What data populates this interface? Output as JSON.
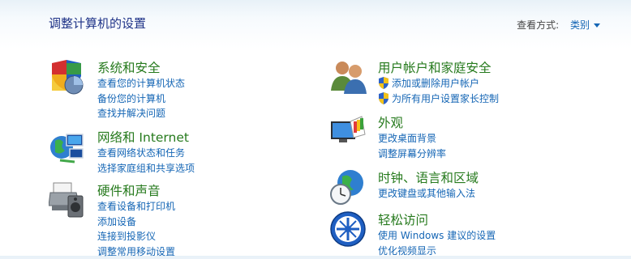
{
  "page_title": "调整计算机的设置",
  "view_by": {
    "label": "查看方式:",
    "value": "类别"
  },
  "categories_left": [
    {
      "heading": "系统和安全",
      "icon": "shield-security-icon",
      "links": [
        "查看您的计算机状态",
        "备份您的计算机",
        "查找并解决问题"
      ]
    },
    {
      "heading": "网络和 Internet",
      "icon": "network-globe-icon",
      "links": [
        "查看网络状态和任务",
        "选择家庭组和共享选项"
      ]
    },
    {
      "heading": "硬件和声音",
      "icon": "printer-speaker-icon",
      "links": [
        "查看设备和打印机",
        "添加设备",
        "连接到投影仪",
        "调整常用移动设置"
      ]
    }
  ],
  "categories_right": [
    {
      "heading": "用户帐户和家庭安全",
      "icon": "users-icon",
      "links": [
        "添加或删除用户帐户",
        "为所有用户设置家长控制"
      ]
    },
    {
      "heading": "外观",
      "icon": "monitor-palette-icon",
      "links": [
        "更改桌面背景",
        "调整屏幕分辨率"
      ]
    },
    {
      "heading": "时钟、语言和区域",
      "icon": "clock-globe-icon",
      "links": [
        "更改键盘或其他输入法"
      ]
    },
    {
      "heading": "轻松访问",
      "icon": "ease-of-access-icon",
      "links": [
        "使用 Windows 建议的设置",
        "优化视频显示"
      ]
    }
  ],
  "colors": {
    "title": "#1e3287",
    "heading": "#267a1d",
    "link": "#1566b5"
  }
}
